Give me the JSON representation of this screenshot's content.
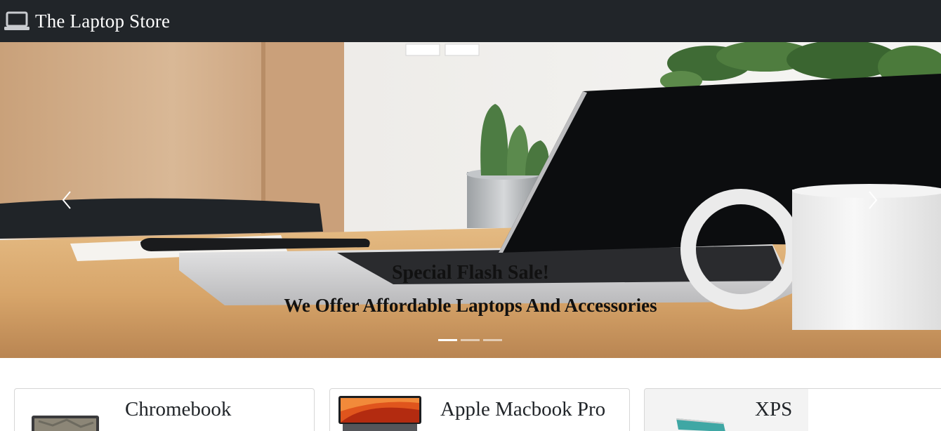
{
  "navbar": {
    "brand_icon": "laptop-icon",
    "brand_name": "The Laptop Store"
  },
  "carousel": {
    "slide_image": "laptop-desk-photo",
    "caption_line1": "Special Flash Sale!",
    "caption_line2": "We Offer Affordable Laptops And Accessories",
    "prev_icon": "chevron-left-icon",
    "next_icon": "chevron-right-icon",
    "slide_count": 3,
    "active_slide": 1
  },
  "products": [
    {
      "title": "Chromebook",
      "image": "chromebook-photo"
    },
    {
      "title": "Apple Macbook Pro",
      "image": "macbook-pro-photo"
    },
    {
      "title": "XPS",
      "image": "xps-laptop-photo"
    }
  ],
  "colors": {
    "navbar_bg": "#212529",
    "caption_text": "#111111",
    "card_border": "#d6d6d6"
  }
}
